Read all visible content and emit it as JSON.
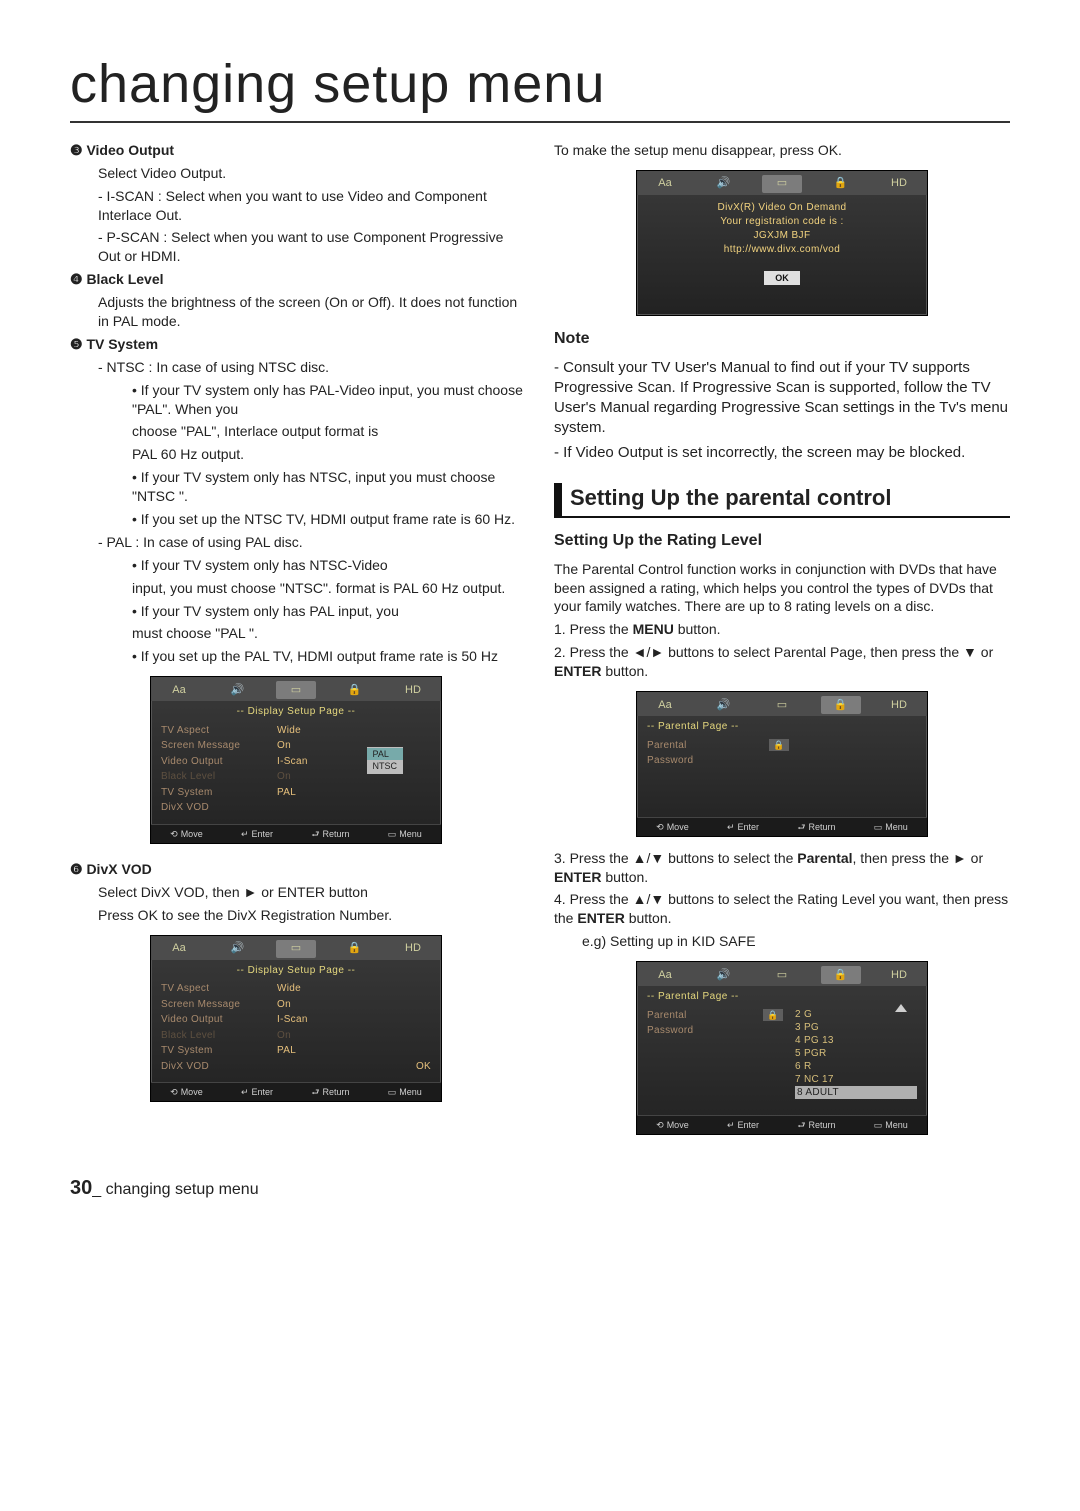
{
  "top_title": "changing setup menu",
  "left": {
    "s3_label": "❸ Video Output",
    "s3_l1": "Select Video Output.",
    "s3_b1": "- I-SCAN : Select when you want to use Video and Component Interlace Out.",
    "s3_b2": "- P-SCAN : Select when you want to use Component Progressive Out or HDMI.",
    "s4_label": "❹ Black Level",
    "s4_l1": "Adjusts the brightness of the screen (On or Off). It does not function in PAL mode.",
    "s5_label": "❺ TV System",
    "s5_b1": "- NTSC : In case of using NTSC disc.",
    "s5_n1": "• If your TV system only has PAL-Video input, you must choose \"PAL\". When you",
    "s5_n2": "choose \"PAL\", Interlace output format is",
    "s5_n3": "PAL 60 Hz output.",
    "s5_n4": "• If your TV system only has NTSC, input you must choose \"NTSC \".",
    "s5_n5": "• If you set up the NTSC TV, HDMI output frame rate is 60 Hz.",
    "s5_b2": "- PAL : In case of using PAL disc.",
    "s5_p1": "• If your TV system only has NTSC-Video",
    "s5_p2": "input, you must choose \"NTSC\". format is PAL 60 Hz output.",
    "s5_p3": "• If your TV system only has PAL input, you",
    "s5_p4": "must choose \"PAL \".",
    "s5_p5": "• If you set up the PAL TV, HDMI output frame rate is 50 Hz",
    "s6_label": "❻ DivX VOD",
    "s6_l1": "Select DivX VOD, then ► or ENTER button",
    "s6_l2": "Press OK to see the DivX Registration Number."
  },
  "osd1": {
    "title": "-- Display Setup Page --",
    "rows": [
      {
        "k": "TV Aspect",
        "v": "Wide"
      },
      {
        "k": "Screen Message",
        "v": "On"
      },
      {
        "k": "Video Output",
        "v": "I-Scan"
      },
      {
        "k": "Black Level",
        "v": "On",
        "dim": true
      },
      {
        "k": "TV System",
        "v": "PAL",
        "popup": [
          "PAL",
          "NTSC"
        ]
      },
      {
        "k": "DivX VOD",
        "v": ""
      }
    ]
  },
  "osd2": {
    "title": "-- Display Setup Page --",
    "rows": [
      {
        "k": "TV Aspect",
        "v": "Wide"
      },
      {
        "k": "Screen Message",
        "v": "On"
      },
      {
        "k": "Video Output",
        "v": "I-Scan"
      },
      {
        "k": "Black Level",
        "v": "On",
        "dim": true
      },
      {
        "k": "TV System",
        "v": "PAL"
      },
      {
        "k": "DivX VOD",
        "v": "",
        "right": "OK"
      }
    ]
  },
  "right": {
    "l1": "To make the setup menu disappear, press OK.",
    "note_label": "Note",
    "note1": "- Consult your TV User's Manual to find out if your TV supports Progressive Scan. If Progressive Scan is supported, follow the TV User's Manual regarding Progressive Scan settings in the Tv's menu system.",
    "note2": "- If Video Output is set incorrectly, the screen may be blocked.",
    "h2": "Setting Up the parental control",
    "sub": "Setting Up the Rating Level",
    "p1": "The Parental Control function works in conjunction with DVDs that have been assigned a rating, which helps you control the types of DVDs that your family watches. There are up to 8 rating levels on a disc.",
    "step1a": "1. Press the ",
    "step1b": "MENU",
    "step1c": " button.",
    "step2a": "2. Press the ◄/► buttons to select Parental Page, then press the ▼ or ",
    "step2b": "ENTER",
    "step2c": " button.",
    "step3a": "3. Press the ▲/▼ buttons to select the ",
    "step3b": "Parental",
    "step3c": ", then press the ► or ",
    "step3d": "ENTER",
    "step3e": " button.",
    "step4a": "4. Press the ▲/▼ buttons to select the Rating Level you want, then press the ",
    "step4b": "ENTER",
    "step4c": " button.",
    "step4d": "e.g) Setting up in KID SAFE"
  },
  "osd3": {
    "lines": [
      "DivX(R) Video On Demand",
      "Your registration code is :",
      "JGXJM BJF",
      "http://www.divx.com/vod"
    ],
    "ok": "OK"
  },
  "osd4": {
    "title": "-- Parental Page --",
    "rows": [
      {
        "k": "Parental",
        "icon": true
      },
      {
        "k": "Password"
      }
    ]
  },
  "osd5": {
    "title": "-- Parental Page --",
    "rows": [
      {
        "k": "Parental",
        "icon": true
      },
      {
        "k": "Password"
      }
    ],
    "list": [
      "2 G",
      "3 PG",
      "4 PG 13",
      "5 PGR",
      "6 R",
      "7 NC 17",
      "8 ADULT"
    ]
  },
  "osd_footer": {
    "move": "Move",
    "enter": "Enter",
    "return": "Return",
    "menu": "Menu"
  },
  "tab_labels": {
    "aa": "Aa",
    "sound": "sound-icon",
    "display": "display-icon",
    "lock": "lock-icon",
    "hd": "HD"
  },
  "footer": {
    "num": "30",
    "sep": "_",
    "text": " changing setup menu"
  }
}
